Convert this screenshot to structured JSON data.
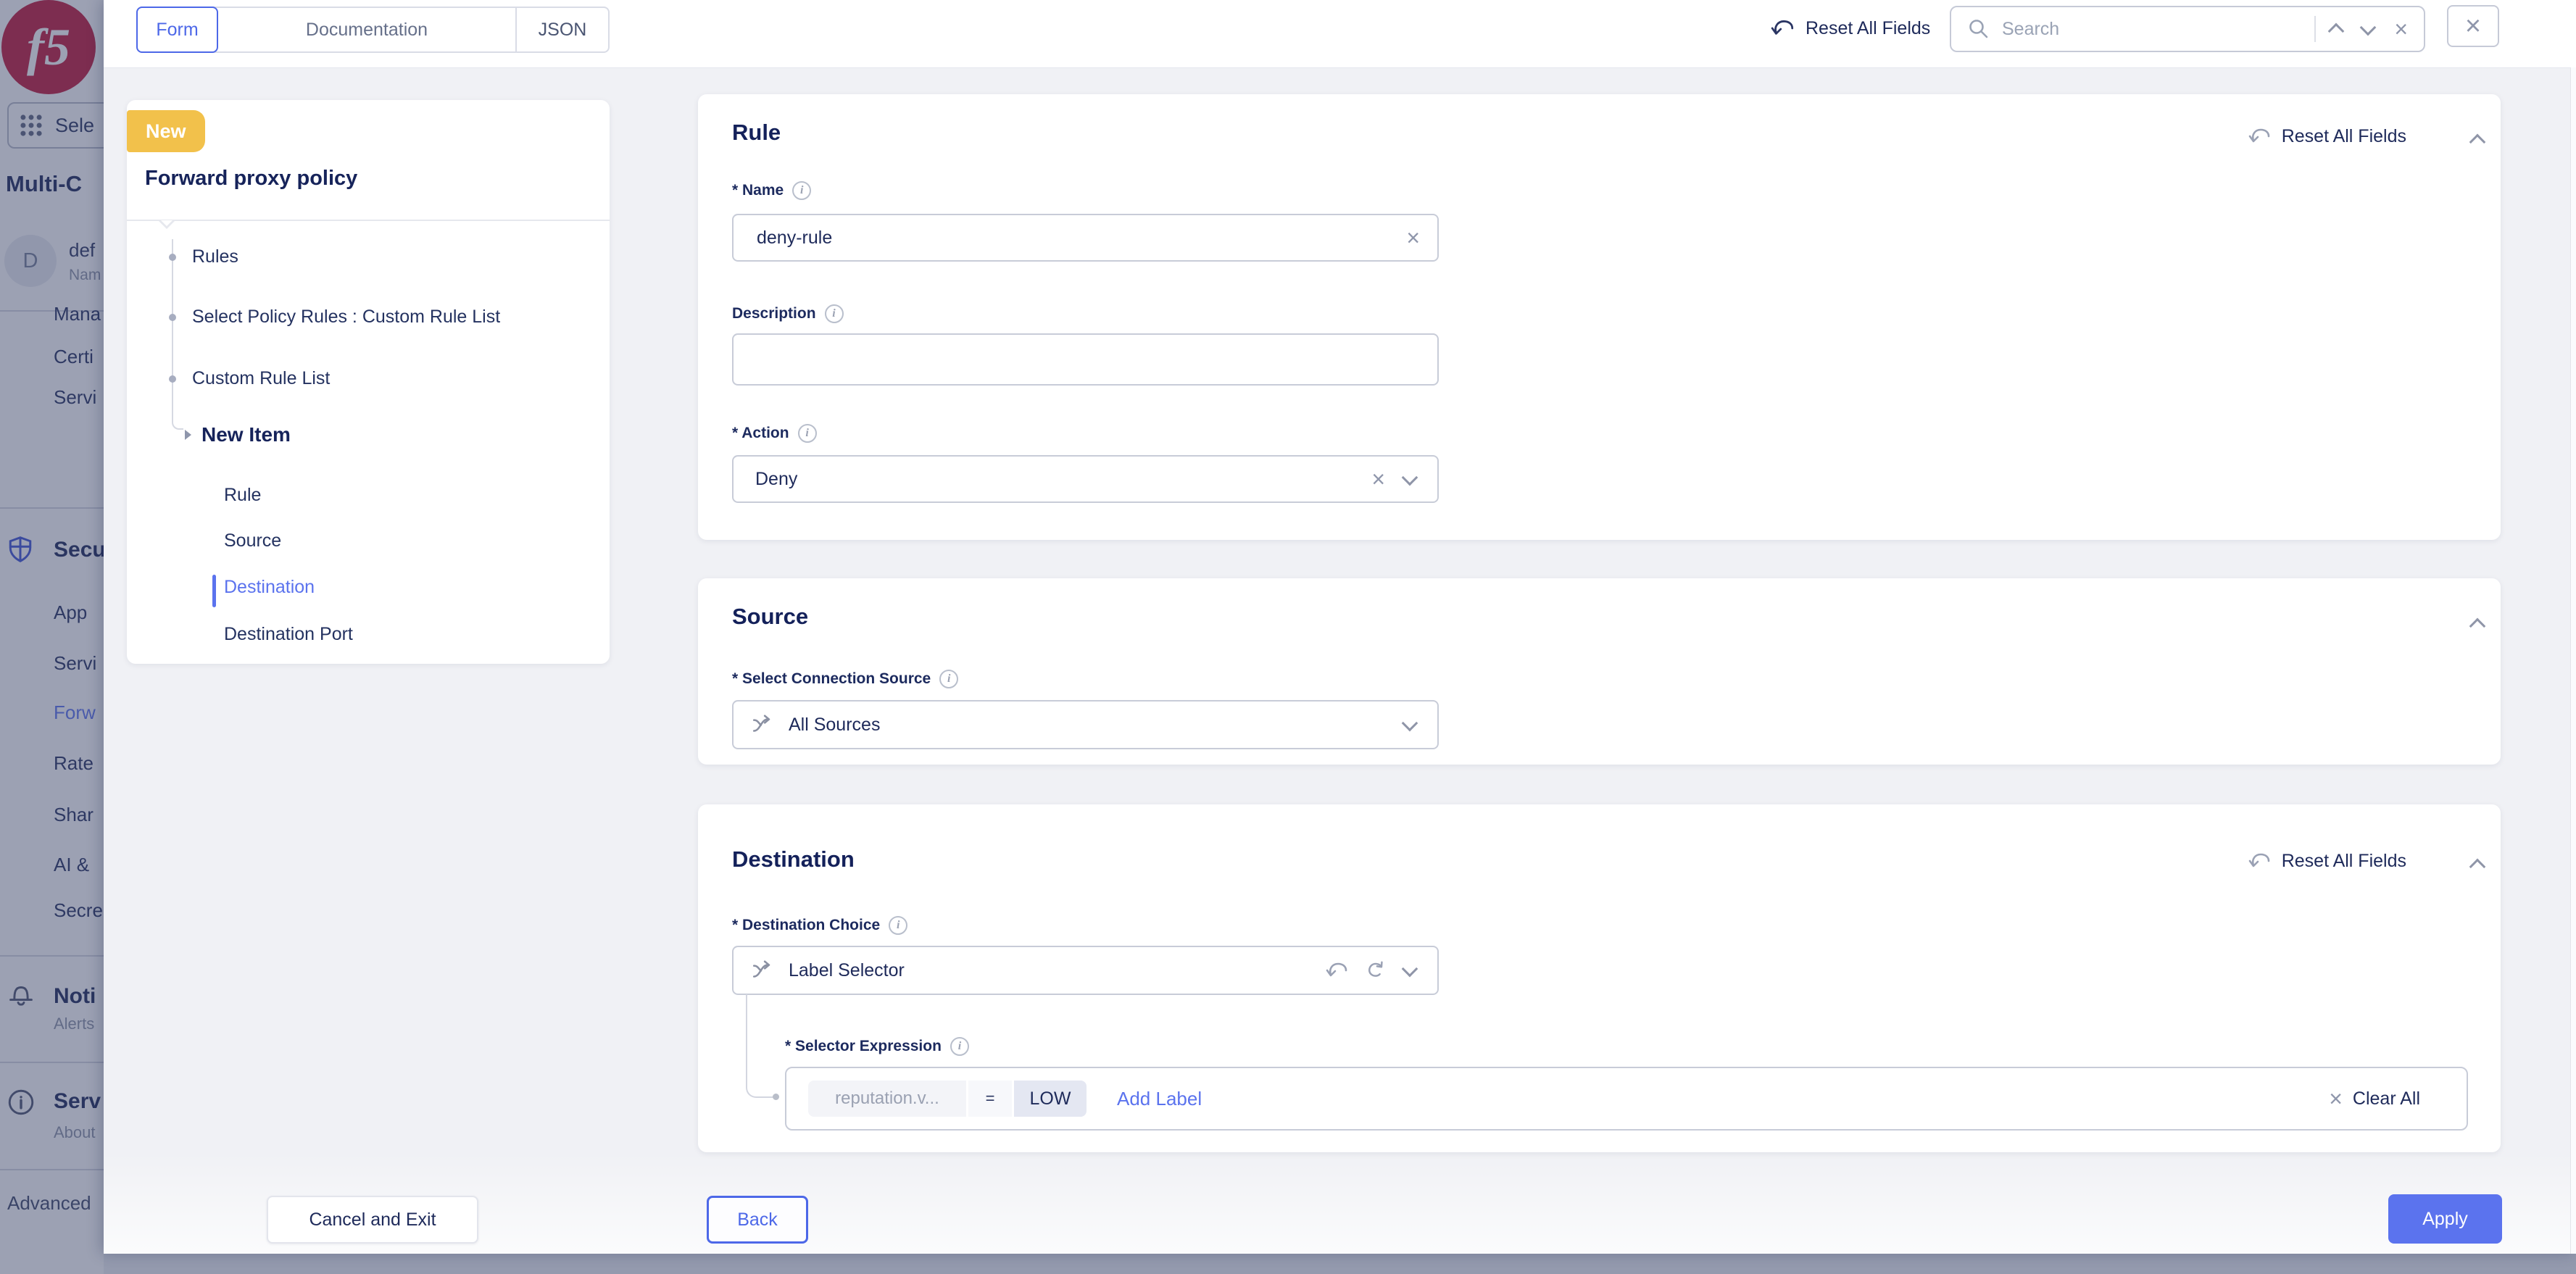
{
  "colors": {
    "accent_blue": "#5b73ee",
    "navy_text": "#1e2a5a",
    "badge_yellow": "#f2c14b",
    "f5_red": "#c01639",
    "page_bg": "#f0f1f5",
    "low_chip_bg": "#e4e7f2"
  },
  "sidebar": {
    "logo_text": "f5",
    "select_service_label": "Sele",
    "workspace_title": "Multi-C",
    "account": {
      "initial": "D",
      "name": "def",
      "subtitle": "Nam"
    },
    "items_general": [
      {
        "label": "Mana"
      },
      {
        "label": "Certi"
      },
      {
        "label": "Servi"
      }
    ],
    "security_header": "Secu",
    "items_security": [
      {
        "label": "App"
      },
      {
        "label": "Servi"
      },
      {
        "label": "Forw"
      },
      {
        "label": "Rate"
      },
      {
        "label": "Shar"
      },
      {
        "label": "AI &"
      },
      {
        "label": "Secre"
      }
    ],
    "notifications": {
      "title": "Noti",
      "subtitle": "Alerts"
    },
    "service_info": {
      "title": "Serv",
      "subtitle": "About"
    },
    "advanced_label": "Advanced"
  },
  "topbar": {
    "tabs": {
      "form": "Form",
      "documentation": "Documentation",
      "json": "JSON"
    },
    "reset_all_fields": "Reset All Fields",
    "search_placeholder": "Search"
  },
  "wizard": {
    "badge": "New",
    "title": "Forward proxy policy",
    "steps": [
      {
        "label": "Rules"
      },
      {
        "label": "Select Policy Rules : Custom Rule List"
      },
      {
        "label": "Custom Rule List"
      }
    ],
    "current_step": "New Item",
    "substeps": [
      {
        "label": "Rule"
      },
      {
        "label": "Source"
      },
      {
        "label": "Destination"
      },
      {
        "label": "Destination Port"
      }
    ]
  },
  "rule_section": {
    "title": "Rule",
    "reset_label": "Reset All Fields",
    "name_label": "* Name",
    "name_value": "deny-rule",
    "description_label": "Description",
    "description_value": "",
    "action_label": "* Action",
    "action_value": "Deny"
  },
  "source_section": {
    "title": "Source",
    "connection_source_label": "* Select Connection Source",
    "connection_source_value": "All Sources"
  },
  "destination_section": {
    "title": "Destination",
    "reset_label": "Reset All Fields",
    "destination_choice_label": "* Destination Choice",
    "destination_choice_value": "Label Selector",
    "selector_expression_label": "* Selector Expression",
    "expression": {
      "key": "reputation.v...",
      "operator": "=",
      "value": "LOW"
    },
    "add_label": "Add Label",
    "clear_all": "Clear All"
  },
  "footer": {
    "cancel": "Cancel and Exit",
    "back": "Back",
    "apply": "Apply"
  }
}
